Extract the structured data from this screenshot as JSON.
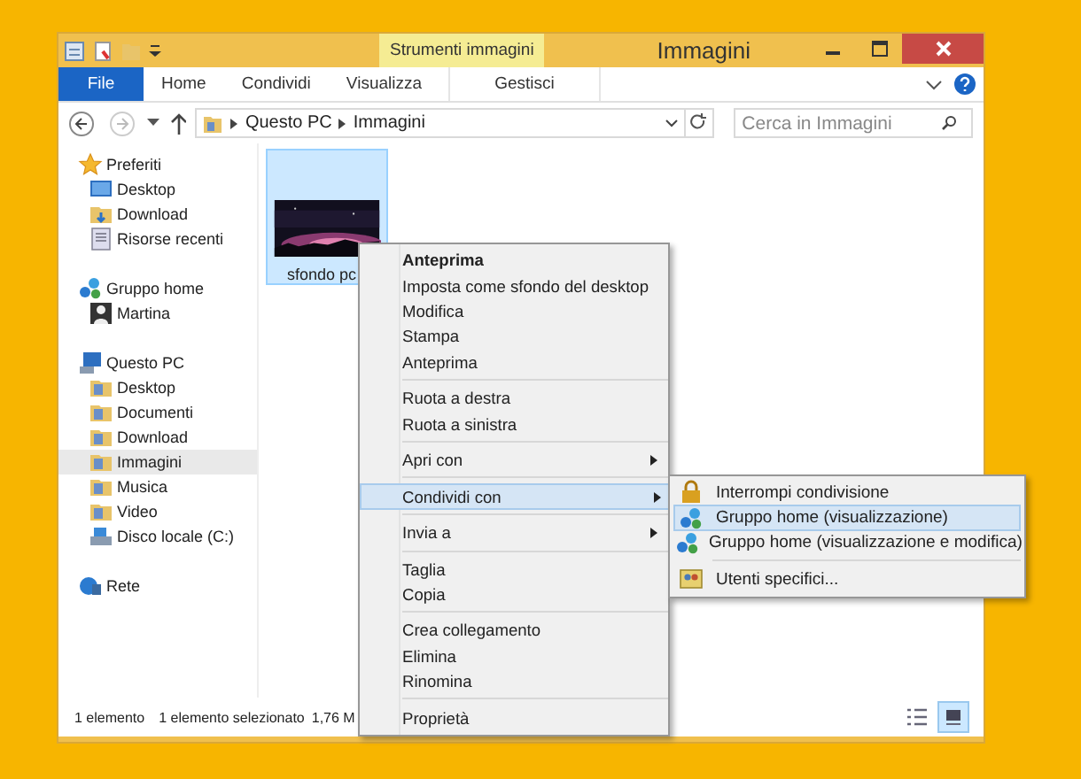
{
  "window": {
    "title": "Immagini",
    "contextual_tab": "Strumenti immagini"
  },
  "ribbon_tabs": [
    {
      "label": "File",
      "kind": "file",
      "selected": false
    },
    {
      "label": "Home",
      "kind": "tab",
      "selected": false
    },
    {
      "label": "Condividi",
      "kind": "tab",
      "selected": false
    },
    {
      "label": "Visualizza",
      "kind": "tab",
      "selected": false
    },
    {
      "label": "Gestisci",
      "kind": "contextual",
      "selected": false
    }
  ],
  "address": {
    "crumbs": [
      "Questo PC",
      "Immagini"
    ]
  },
  "search": {
    "placeholder": "Cerca in Immagini"
  },
  "nav": [
    {
      "label": "Preferiti",
      "kind": "star",
      "selected": false,
      "children": [
        {
          "label": "Desktop",
          "kind": "desktop",
          "selected": false
        },
        {
          "label": "Download",
          "kind": "download",
          "selected": false
        },
        {
          "label": "Risorse recenti",
          "kind": "recent",
          "selected": false
        }
      ]
    },
    {
      "label": "Gruppo home",
      "kind": "homegroup",
      "selected": false,
      "children": [
        {
          "label": "Martina",
          "kind": "user",
          "selected": false
        }
      ]
    },
    {
      "label": "Questo PC",
      "kind": "pc",
      "selected": false,
      "children": [
        {
          "label": "Desktop",
          "kind": "folder",
          "selected": false
        },
        {
          "label": "Documenti",
          "kind": "folder",
          "selected": false
        },
        {
          "label": "Download",
          "kind": "folder",
          "selected": false
        },
        {
          "label": "Immagini",
          "kind": "folder",
          "selected": true
        },
        {
          "label": "Musica",
          "kind": "folder",
          "selected": false
        },
        {
          "label": "Video",
          "kind": "folder",
          "selected": false
        },
        {
          "label": "Disco locale (C:)",
          "kind": "drive",
          "selected": false
        }
      ]
    },
    {
      "label": "Rete",
      "kind": "network",
      "selected": false
    }
  ],
  "files": [
    {
      "name": "sfondo pc",
      "kind": "picture",
      "selected": true
    }
  ],
  "context_menu": [
    [
      {
        "label": "Anteprima",
        "bold": true,
        "submenu": false,
        "selected": false
      },
      {
        "label": "Imposta come sfondo del desktop",
        "bold": false,
        "submenu": false,
        "selected": false
      },
      {
        "label": "Modifica",
        "bold": false,
        "submenu": false,
        "selected": false
      },
      {
        "label": "Stampa",
        "bold": false,
        "submenu": false,
        "selected": false
      },
      {
        "label": "Anteprima",
        "bold": false,
        "submenu": false,
        "selected": false
      }
    ],
    [
      {
        "label": "Ruota a destra",
        "bold": false,
        "submenu": false,
        "selected": false
      },
      {
        "label": "Ruota a sinistra",
        "bold": false,
        "submenu": false,
        "selected": false
      }
    ],
    [
      {
        "label": "Apri con",
        "bold": false,
        "submenu": true,
        "selected": false
      }
    ],
    [
      {
        "label": "Condividi con",
        "bold": false,
        "submenu": true,
        "selected": true
      }
    ],
    [
      {
        "label": "Invia a",
        "bold": false,
        "submenu": true,
        "selected": false
      }
    ],
    [
      {
        "label": "Taglia",
        "bold": false,
        "submenu": false,
        "selected": false
      },
      {
        "label": "Copia",
        "bold": false,
        "submenu": false,
        "selected": false
      }
    ],
    [
      {
        "label": "Crea collegamento",
        "bold": false,
        "submenu": false,
        "selected": false
      },
      {
        "label": "Elimina",
        "bold": false,
        "submenu": false,
        "selected": false
      },
      {
        "label": "Rinomina",
        "bold": false,
        "submenu": false,
        "selected": false
      }
    ],
    [
      {
        "label": "Proprietà",
        "bold": false,
        "submenu": false,
        "selected": false
      }
    ]
  ],
  "share_submenu": [
    [
      {
        "label": "Interrompi condivisione",
        "kind": "lock",
        "selected": false
      },
      {
        "label": "Gruppo home (visualizzazione)",
        "kind": "homegroup",
        "selected": true
      },
      {
        "label": "Gruppo home (visualizzazione e modifica)",
        "kind": "homegroup",
        "selected": false
      }
    ],
    [
      {
        "label": "Utenti specifici...",
        "kind": "users",
        "selected": false
      }
    ]
  ],
  "status_bar": {
    "items": [
      "1 elemento",
      "1 elemento selezionato",
      "1,76 M"
    ],
    "views": [
      {
        "kind": "details",
        "selected": false
      },
      {
        "kind": "icons",
        "selected": true
      }
    ]
  }
}
